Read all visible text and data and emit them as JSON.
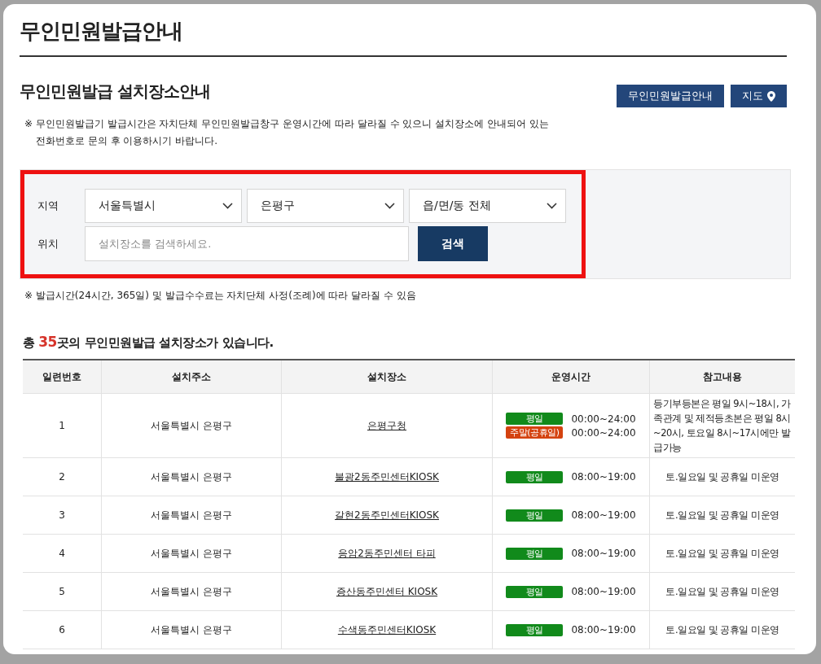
{
  "page_title": "무인민원발급안내",
  "section_title": "무인민원발급 설치장소안내",
  "header_buttons": [
    {
      "label": "무인민원발급안내",
      "kind": "text"
    },
    {
      "label": "지도",
      "kind": "map"
    }
  ],
  "notice": "※ 무인민원발급기 발급시간은 자치단체 무인민원발급창구 운영시간에 따라 달라질 수 있으니 설치장소에 안내되어 있는 전화번호로 문의 후 이용하시기 바랍니다.",
  "search": {
    "highlighted": true,
    "region_label": "지역",
    "selects": [
      "서울특별시",
      "은평구",
      "읍/면/동 전체"
    ],
    "location_label": "위치",
    "placeholder": "설치장소를 검색하세요.",
    "button": "검색"
  },
  "fee_note": "※ 발급시간(24시간, 365일) 및 발급수수료는 자치단체 사정(조례)에 따라 달라질 수 있음",
  "summary": {
    "prefix": "총 ",
    "count": "35",
    "suffix": "곳의 무인민원발급 설치장소가 있습니다."
  },
  "table": {
    "columns": [
      "일련번호",
      "설치주소",
      "설치장소",
      "운영시간",
      "참고내용"
    ],
    "rows": [
      {
        "no": "1",
        "address": "서울특별시 은평구",
        "place": "은평구청",
        "hours": [
          {
            "kind": "weekday",
            "badge": "평일",
            "time": "00:00~24:00"
          },
          {
            "kind": "weekend",
            "badge": "주말(공휴일)",
            "time": "00:00~24:00"
          }
        ],
        "note": "등기부등본은 평일 9시~18시, 가족관계 및 제적등초본은 평일 8시~20시, 토요일 8시~17시에만 발급가능"
      },
      {
        "no": "2",
        "address": "서울특별시 은평구",
        "place": "불광2동주민센터KIOSK",
        "hours": [
          {
            "kind": "weekday",
            "badge": "평일",
            "time": "08:00~19:00"
          }
        ],
        "note": "토.일요일 및 공휴일 미운영"
      },
      {
        "no": "3",
        "address": "서울특별시 은평구",
        "place": "갈현2동주민센터KIOSK",
        "hours": [
          {
            "kind": "weekday",
            "badge": "평일",
            "time": "08:00~19:00"
          }
        ],
        "note": "토.일요일 및 공휴일 미운영"
      },
      {
        "no": "4",
        "address": "서울특별시 은평구",
        "place": "응암2동주민센터 타피",
        "hours": [
          {
            "kind": "weekday",
            "badge": "평일",
            "time": "08:00~19:00"
          }
        ],
        "note": "토.일요일 및 공휴일 미운영"
      },
      {
        "no": "5",
        "address": "서울특별시 은평구",
        "place": "증산동주민센터 KIOSK",
        "hours": [
          {
            "kind": "weekday",
            "badge": "평일",
            "time": "08:00~19:00"
          }
        ],
        "note": "토.일요일 및 공휴일 미운영"
      },
      {
        "no": "6",
        "address": "서울특별시 은평구",
        "place": "수색동주민센터KIOSK",
        "hours": [
          {
            "kind": "weekday",
            "badge": "평일",
            "time": "08:00~19:00"
          }
        ],
        "note": "토.일요일 및 공휴일 미운영"
      }
    ]
  }
}
